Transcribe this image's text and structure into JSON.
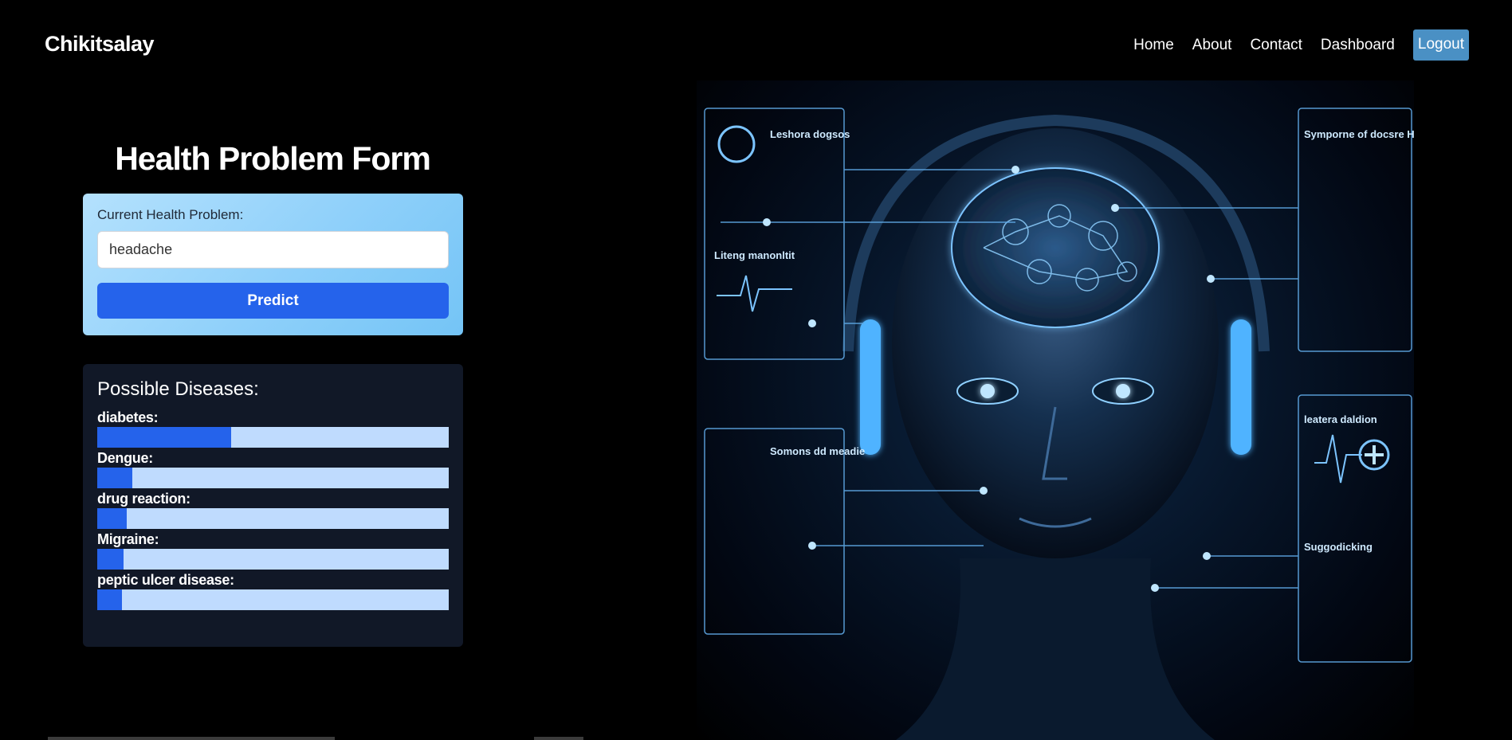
{
  "navbar": {
    "brand": "Chikitsalay",
    "links": [
      "Home",
      "About",
      "Contact",
      "Dashboard"
    ],
    "logout_label": "Logout"
  },
  "form": {
    "title": "Health Problem Form",
    "field_label": "Current Health Problem:",
    "input_value": "headache",
    "predict_label": "Predict"
  },
  "results": {
    "title": "Possible Diseases:",
    "diseases": [
      {
        "name": "diabetes:",
        "fraction": 0.38
      },
      {
        "name": "Dengue:",
        "fraction": 0.1
      },
      {
        "name": "drug reaction:",
        "fraction": 0.085
      },
      {
        "name": "Migraine:",
        "fraction": 0.075
      },
      {
        "name": "peptic ulcer disease:",
        "fraction": 0.07
      }
    ]
  },
  "hero": {
    "panel_texts": [
      "Leshora dogsos",
      "Liteng manonltit",
      "Symporne of docsre Hrelonn",
      "Somons dd meadie",
      "leatera daldion",
      "Suggodicking"
    ]
  },
  "colors": {
    "background": "#000000",
    "accent": "#2563eb",
    "bar_track": "#bfdbfe",
    "logout_button": "#4a90c4",
    "results_card": "#111827",
    "glow": "#5fb6ff"
  }
}
